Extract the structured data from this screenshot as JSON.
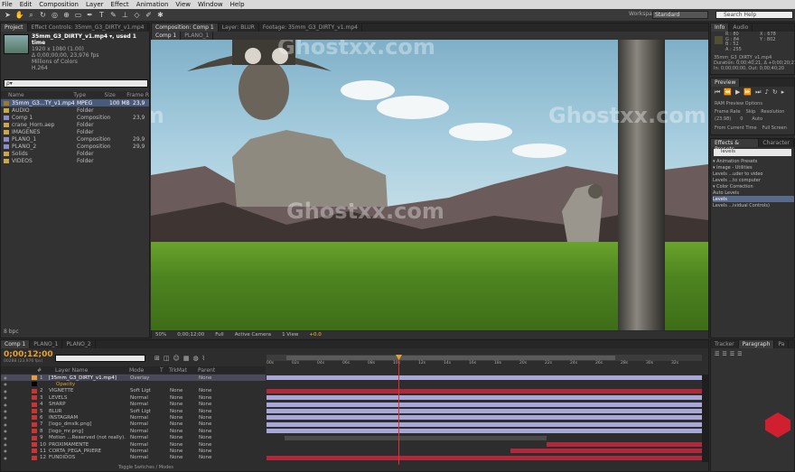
{
  "menubar": {
    "items": [
      "File",
      "Edit",
      "Composition",
      "Layer",
      "Effect",
      "Animation",
      "View",
      "Window",
      "Help"
    ]
  },
  "toolbar": {
    "workspace_label": "Workspace:",
    "workspace_value": "Standard",
    "search_placeholder": "Search Help"
  },
  "project": {
    "tabs": [
      "Project",
      "Effect Controls: 35mm_G3_DIRTY_v1.mp4"
    ],
    "item_name": "35mm_G3_DIRTY_v1.mp4 ▾, used 1 time",
    "item_info": [
      "1920 x 1080 (1.00)",
      "Δ 0;00;00;00, 23,976 fps",
      "Millions of Colors",
      "H.264"
    ],
    "search_placeholder": "ρ▾",
    "columns": [
      "Name",
      "Type",
      "Size",
      "Frame R"
    ],
    "rows": [
      {
        "name": "35mm_G3...TY_v1.mp4",
        "type": "MPEG",
        "size": "100 MB",
        "fr": "23,9",
        "icon": "footage"
      },
      {
        "name": "AUDIO",
        "type": "Folder",
        "size": "",
        "fr": "",
        "icon": "folder"
      },
      {
        "name": "Comp 1",
        "type": "Composition",
        "size": "",
        "fr": "23,9",
        "icon": "comp"
      },
      {
        "name": "crane_Horn.aep",
        "type": "Folder",
        "size": "",
        "fr": "",
        "icon": "folder"
      },
      {
        "name": "IMAGENES",
        "type": "Folder",
        "size": "",
        "fr": "",
        "icon": "folder"
      },
      {
        "name": "PLANO_1",
        "type": "Composition",
        "size": "",
        "fr": "29,9",
        "icon": "comp"
      },
      {
        "name": "PLANO_2",
        "type": "Composition",
        "size": "",
        "fr": "29,9",
        "icon": "comp"
      },
      {
        "name": "Solids",
        "type": "Folder",
        "size": "",
        "fr": "",
        "icon": "folder"
      },
      {
        "name": "VIDEOS",
        "type": "Folder",
        "size": "",
        "fr": "",
        "icon": "folder"
      }
    ],
    "footer": "8 bpc"
  },
  "comp_viewer": {
    "tabs": [
      "Composition: Comp 1",
      "Layer: BLUR",
      "Footage: 35mm_G3_DIRTY_v1.mp4"
    ],
    "subtabs": [
      "Comp 1",
      "PLANO_1"
    ],
    "bottom_bar": [
      "50%",
      "0;00;12;00",
      "Full",
      "Active Camera",
      "1 View",
      "+0.0"
    ]
  },
  "info": {
    "tabs": [
      "Info",
      "Audio"
    ],
    "values": [
      "R : 80",
      "G : 84",
      "B : 52",
      "A : 255",
      "X : 678",
      "Y : 802"
    ],
    "desc": [
      "35mm_G3_DIRTY_v1.mp4",
      "Duration: 0;00;40;21, Δ +0;00;20;21",
      "In: 0;00;00;00, Out: 0;00;40;20"
    ]
  },
  "preview": {
    "tab": "Preview",
    "options": "RAM Preview Options",
    "frame_rate_label": "Frame Rate",
    "skip_label": "Skip",
    "resolution_label": "Resolution",
    "frame_rate": "(23.98)",
    "skip": "0",
    "resolution": "Auto",
    "from_current": "From Current Time",
    "full_screen": "Full Screen"
  },
  "effects": {
    "tabs": [
      "Effects & Presets",
      "Character"
    ],
    "search": "levels",
    "tree": [
      "▾ Animation Presets",
      "  ▾ Image - Utilities",
      "      Levels ...uder to video",
      "      Levels ...to computer",
      "▾ Color Correction",
      "      Auto Levels",
      "      Levels",
      "      Levels ...ividual Controls)"
    ]
  },
  "timeline": {
    "tabs": [
      "Comp 1",
      "PLANO_1",
      "PLANO_2"
    ],
    "timecode": "0;00;12;00",
    "fps_note": "00288 (23.976 fps)",
    "columns": [
      "#",
      "Layer Name",
      "Mode",
      "T",
      "TrkMat",
      "Parent"
    ],
    "ruler": [
      "00s",
      "02s",
      "04s",
      "06s",
      "08s",
      "10s",
      "12s",
      "14s",
      "16s",
      "18s",
      "20s",
      "22s",
      "24s",
      "26s",
      "28s",
      "30s",
      "32s"
    ],
    "layers": [
      {
        "num": "1",
        "name": "[35mm_G3_DIRTY_v1.mp4]",
        "mode": "Overlay",
        "trk": "",
        "parent": "None",
        "color": "#e8a030"
      },
      {
        "num": "",
        "name": "Opacity",
        "mode": "",
        "trk": "",
        "parent": "",
        "color": "#000000"
      },
      {
        "num": "2",
        "name": "VIGNETTE",
        "mode": "Soft Ligt",
        "trk": "None",
        "parent": "None",
        "color": "#cc3333"
      },
      {
        "num": "3",
        "name": "LEVELS",
        "mode": "Normal",
        "trk": "None",
        "parent": "None",
        "color": "#cc3333"
      },
      {
        "num": "4",
        "name": "SHARP",
        "mode": "Normal",
        "trk": "None",
        "parent": "None",
        "color": "#cc3333"
      },
      {
        "num": "5",
        "name": "BLUR",
        "mode": "Soft Ligt",
        "trk": "None",
        "parent": "None",
        "color": "#cc3333"
      },
      {
        "num": "6",
        "name": "INSTAGRAM",
        "mode": "Normal",
        "trk": "None",
        "parent": "None",
        "color": "#cc3333"
      },
      {
        "num": "7",
        "name": "[logo_dmslk.png]",
        "mode": "Normal",
        "trk": "None",
        "parent": "None",
        "color": "#cc3333"
      },
      {
        "num": "8",
        "name": "[logo_mr.png]",
        "mode": "Normal",
        "trk": "None",
        "parent": "None",
        "color": "#cc3333"
      },
      {
        "num": "9",
        "name": "Motion ...Reserved (not really).",
        "mode": "Normal",
        "trk": "None",
        "parent": "None",
        "color": "#cc3333"
      },
      {
        "num": "10",
        "name": "PROXIMAMENTE",
        "mode": "Normal",
        "trk": "None",
        "parent": "None",
        "color": "#cc3333"
      },
      {
        "num": "11",
        "name": "CORTA_PEGA_PRIERE",
        "mode": "Normal",
        "trk": "None",
        "parent": "None",
        "color": "#cc3333"
      },
      {
        "num": "12",
        "name": "FUNDIDOS",
        "mode": "Normal",
        "trk": "None",
        "parent": "None",
        "color": "#cc3333"
      }
    ],
    "bottom": "Toggle Switches / Modes"
  },
  "right_lower": {
    "tabs": [
      "Tracker",
      "Paragraph",
      "Pa"
    ]
  },
  "watermark": "Ghostxx.com",
  "colors": {
    "accent": "#e8a030",
    "layer_bar": "#a8a8d8",
    "red_bar": "#b0283c",
    "playhead": "#e03030"
  }
}
